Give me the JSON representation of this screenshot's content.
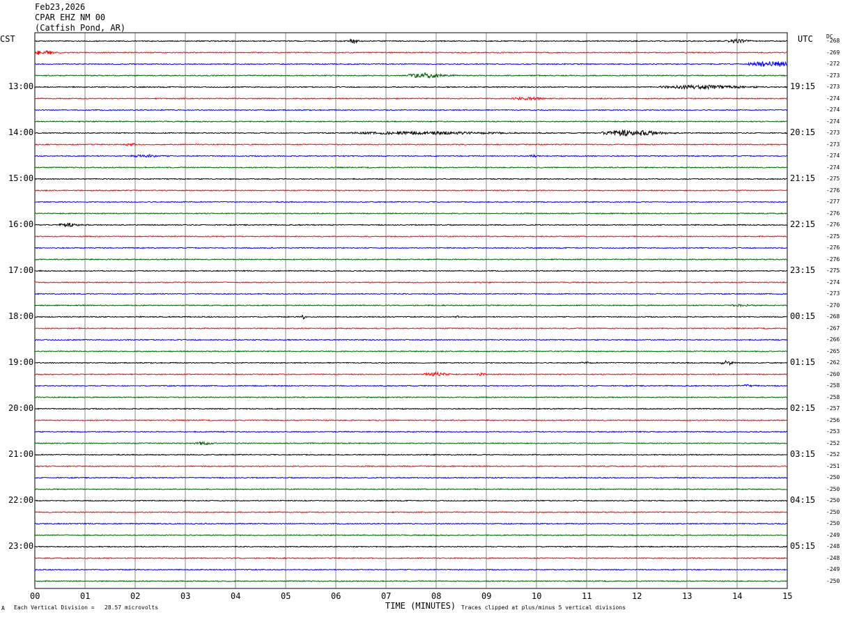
{
  "header": {
    "date": "Feb23,2026",
    "station": "CPAR EHZ NM 00",
    "location": "(Catfish Pond, AR)"
  },
  "left_tz": "CST",
  "right_tz": "UTC",
  "dc_label": "DC",
  "footer": {
    "scale_note": "Each Vertical Division =   28.57 microvolts",
    "axis_title": "TIME (MINUTES)",
    "clip_note": "Traces clipped at plus/minus 5 vertical divisions",
    "corner_mark": "A"
  },
  "colors": {
    "trace_cycle": [
      "#000000",
      "#ff0000",
      "#0000ff",
      "#006400"
    ],
    "grid": "#000000"
  },
  "chart_data": {
    "type": "line",
    "title": "",
    "xlabel": "TIME (MINUTES)",
    "ylabel": "",
    "xlim": [
      0,
      15
    ],
    "x_tick_labels": [
      "00",
      "01",
      "02",
      "03",
      "04",
      "05",
      "06",
      "07",
      "08",
      "09",
      "10",
      "11",
      "12",
      "13",
      "14",
      "15"
    ],
    "trace_count": 48,
    "traces_per_hour": 4,
    "grid": "vertical lines each minute",
    "left_hour_labels": [
      "13:00",
      "14:00",
      "15:00",
      "16:00",
      "17:00",
      "18:00",
      "19:00",
      "20:00",
      "21:00",
      "22:00",
      "23:00"
    ],
    "right_hour_labels": [
      "19:15",
      "20:15",
      "21:15",
      "22:15",
      "23:15",
      "00:15",
      "01:15",
      "02:15",
      "03:15",
      "04:15",
      "05:15"
    ],
    "dc_offsets": [
      -268,
      -269,
      -272,
      -273,
      -273,
      -274,
      -274,
      -274,
      -273,
      -273,
      -274,
      -274,
      -275,
      -276,
      -277,
      -276,
      -276,
      -275,
      -276,
      -276,
      -275,
      -274,
      -273,
      -270,
      -268,
      -267,
      -266,
      -265,
      -262,
      -260,
      -258,
      -258,
      -257,
      -256,
      -253,
      -252,
      -252,
      -251,
      -250,
      -250,
      -250,
      -250,
      -250,
      -249,
      -248,
      -248,
      -249,
      -250
    ],
    "events": [
      {
        "trace": 0,
        "minute": 6.35,
        "amp": 2.2,
        "dur": 0.15
      },
      {
        "trace": 0,
        "minute": 14.0,
        "amp": 1.4,
        "dur": 0.4
      },
      {
        "trace": 1,
        "minute": 0.15,
        "amp": 2.0,
        "dur": 0.4
      },
      {
        "trace": 2,
        "minute": 14.7,
        "amp": 2.3,
        "dur": 0.8
      },
      {
        "trace": 3,
        "minute": 7.8,
        "amp": 2.2,
        "dur": 0.6
      },
      {
        "trace": 4,
        "minute": 13.3,
        "amp": 1.5,
        "dur": 1.4
      },
      {
        "trace": 5,
        "minute": 9.8,
        "amp": 1.2,
        "dur": 0.5
      },
      {
        "trace": 8,
        "minute": 11.9,
        "amp": 2.5,
        "dur": 1.0
      },
      {
        "trace": 8,
        "minute": 7.8,
        "amp": 1.0,
        "dur": 2.5
      },
      {
        "trace": 9,
        "minute": 1.9,
        "amp": 1.0,
        "dur": 0.2
      },
      {
        "trace": 10,
        "minute": 2.2,
        "amp": 1.0,
        "dur": 0.5
      },
      {
        "trace": 10,
        "minute": 9.95,
        "amp": 0.9,
        "dur": 0.15
      },
      {
        "trace": 16,
        "minute": 0.7,
        "amp": 1.3,
        "dur": 0.4
      },
      {
        "trace": 23,
        "minute": 14.1,
        "amp": 0.6,
        "dur": 0.4
      },
      {
        "trace": 24,
        "minute": 5.35,
        "amp": 1.8,
        "dur": 0.08
      },
      {
        "trace": 24,
        "minute": 8.4,
        "amp": 1.2,
        "dur": 0.08
      },
      {
        "trace": 28,
        "minute": 13.8,
        "amp": 1.8,
        "dur": 0.2
      },
      {
        "trace": 28,
        "minute": 11.0,
        "amp": 0.6,
        "dur": 0.2
      },
      {
        "trace": 29,
        "minute": 8.0,
        "amp": 1.5,
        "dur": 0.4
      },
      {
        "trace": 29,
        "minute": 8.9,
        "amp": 1.0,
        "dur": 0.15
      },
      {
        "trace": 30,
        "minute": 14.2,
        "amp": 0.8,
        "dur": 0.3
      },
      {
        "trace": 35,
        "minute": 3.35,
        "amp": 1.2,
        "dur": 0.3
      }
    ]
  }
}
